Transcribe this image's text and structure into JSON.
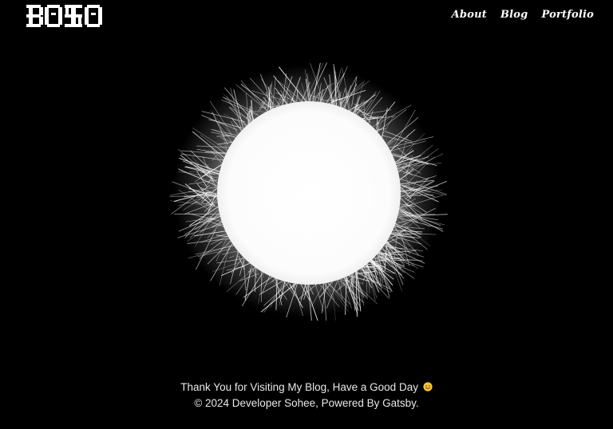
{
  "header": {
    "logo_text": "BOXO",
    "nav": [
      {
        "label": "About"
      },
      {
        "label": "Blog"
      },
      {
        "label": "Portfolio"
      }
    ]
  },
  "hero": {
    "image": "glowing-white-sun-scribble",
    "colors": {
      "background": "#000000",
      "sun": "#ffffff"
    }
  },
  "footer": {
    "thanks": "Thank You for Visiting My Blog, Have a Good Day",
    "emoji": "smiling-face-emoji",
    "copyright": "© 2024 Developer Sohee, Powered By Gatsby."
  }
}
